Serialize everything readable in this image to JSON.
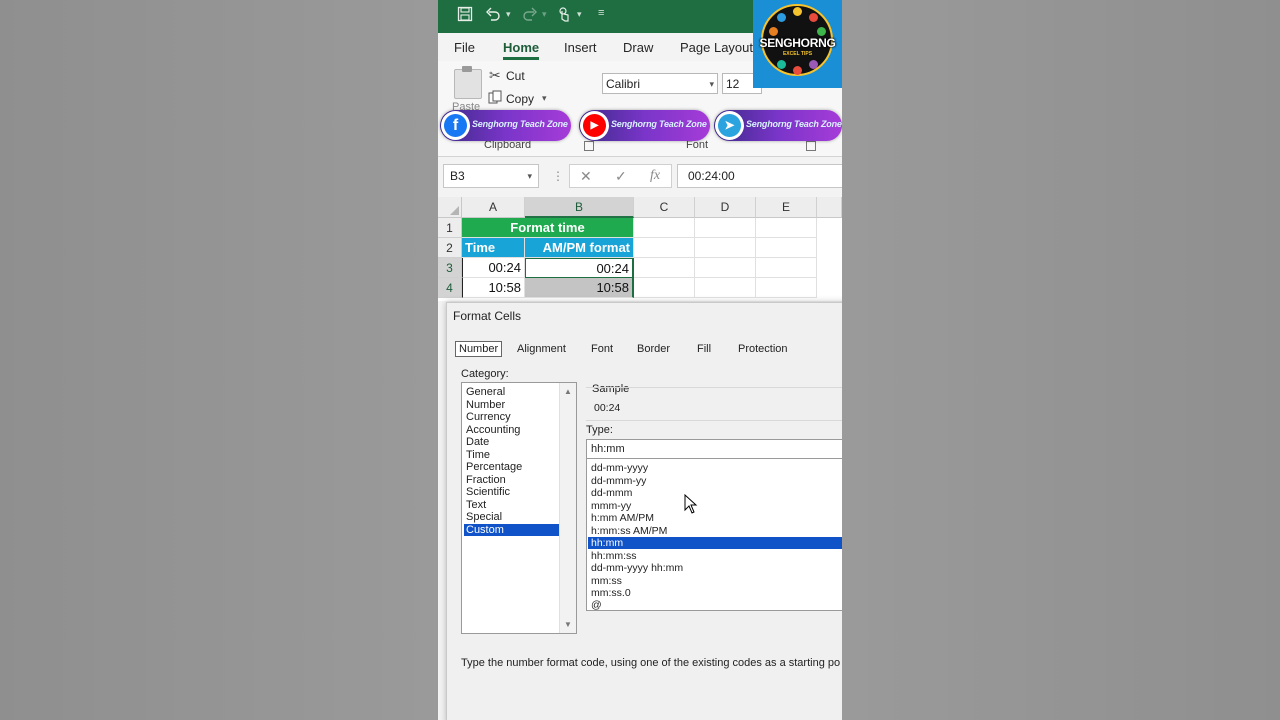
{
  "colors": {
    "accent": "#1e6e42",
    "header_green": "#1faa4f",
    "header_blue": "#19a4d8",
    "selection": "#1052c8"
  },
  "ribbon": {
    "tabs": [
      "File",
      "Home",
      "Insert",
      "Draw",
      "Page Layout"
    ],
    "active_tab": "Home",
    "clipboard": {
      "paste": "Paste",
      "cut": "Cut",
      "copy": "Copy",
      "group": "Clipboard"
    },
    "font": {
      "name": "Calibri",
      "size": "12",
      "group": "Font"
    }
  },
  "overlays": {
    "facebook": "Senghorng Teach Zone",
    "youtube": "Senghorng Teach Zone",
    "telegram": "Senghorng Teach Zone",
    "logo_brand": "SENGHORNG",
    "logo_sub": "EXCEL TIPS"
  },
  "formula_bar": {
    "name_box": "B3",
    "value": "00:24:00"
  },
  "sheet": {
    "columns": [
      "A",
      "B",
      "C",
      "D",
      "E"
    ],
    "rows": [
      "1",
      "2",
      "3",
      "4"
    ],
    "title": "Format time",
    "col_a_header": "Time",
    "col_b_header": "AM/PM format",
    "a3": "00:24",
    "b3": "00:24",
    "a4": "10:58",
    "b4": "10:58"
  },
  "dialog": {
    "title": "Format Cells",
    "tabs": [
      "Number",
      "Alignment",
      "Font",
      "Border",
      "Fill",
      "Protection"
    ],
    "active_tab": "Number",
    "category_label": "Category:",
    "categories": [
      "General",
      "Number",
      "Currency",
      "Accounting",
      "Date",
      "Time",
      "Percentage",
      "Fraction",
      "Scientific",
      "Text",
      "Special",
      "Custom"
    ],
    "selected_category": "Custom",
    "sample_label": "Sample",
    "sample_value": "00:24",
    "type_label": "Type:",
    "type_value": "hh:mm",
    "types": [
      "dd-mm-yyyy",
      "dd-mmm-yy",
      "dd-mmm",
      "mmm-yy",
      "h:mm AM/PM",
      "h:mm:ss AM/PM",
      "hh:mm",
      "hh:mm:ss",
      "dd-mm-yyyy hh:mm",
      "mm:ss",
      "mm:ss.0",
      "@"
    ],
    "selected_type": "hh:mm",
    "hint": "Type the number format code, using one of the existing codes as a starting po"
  }
}
